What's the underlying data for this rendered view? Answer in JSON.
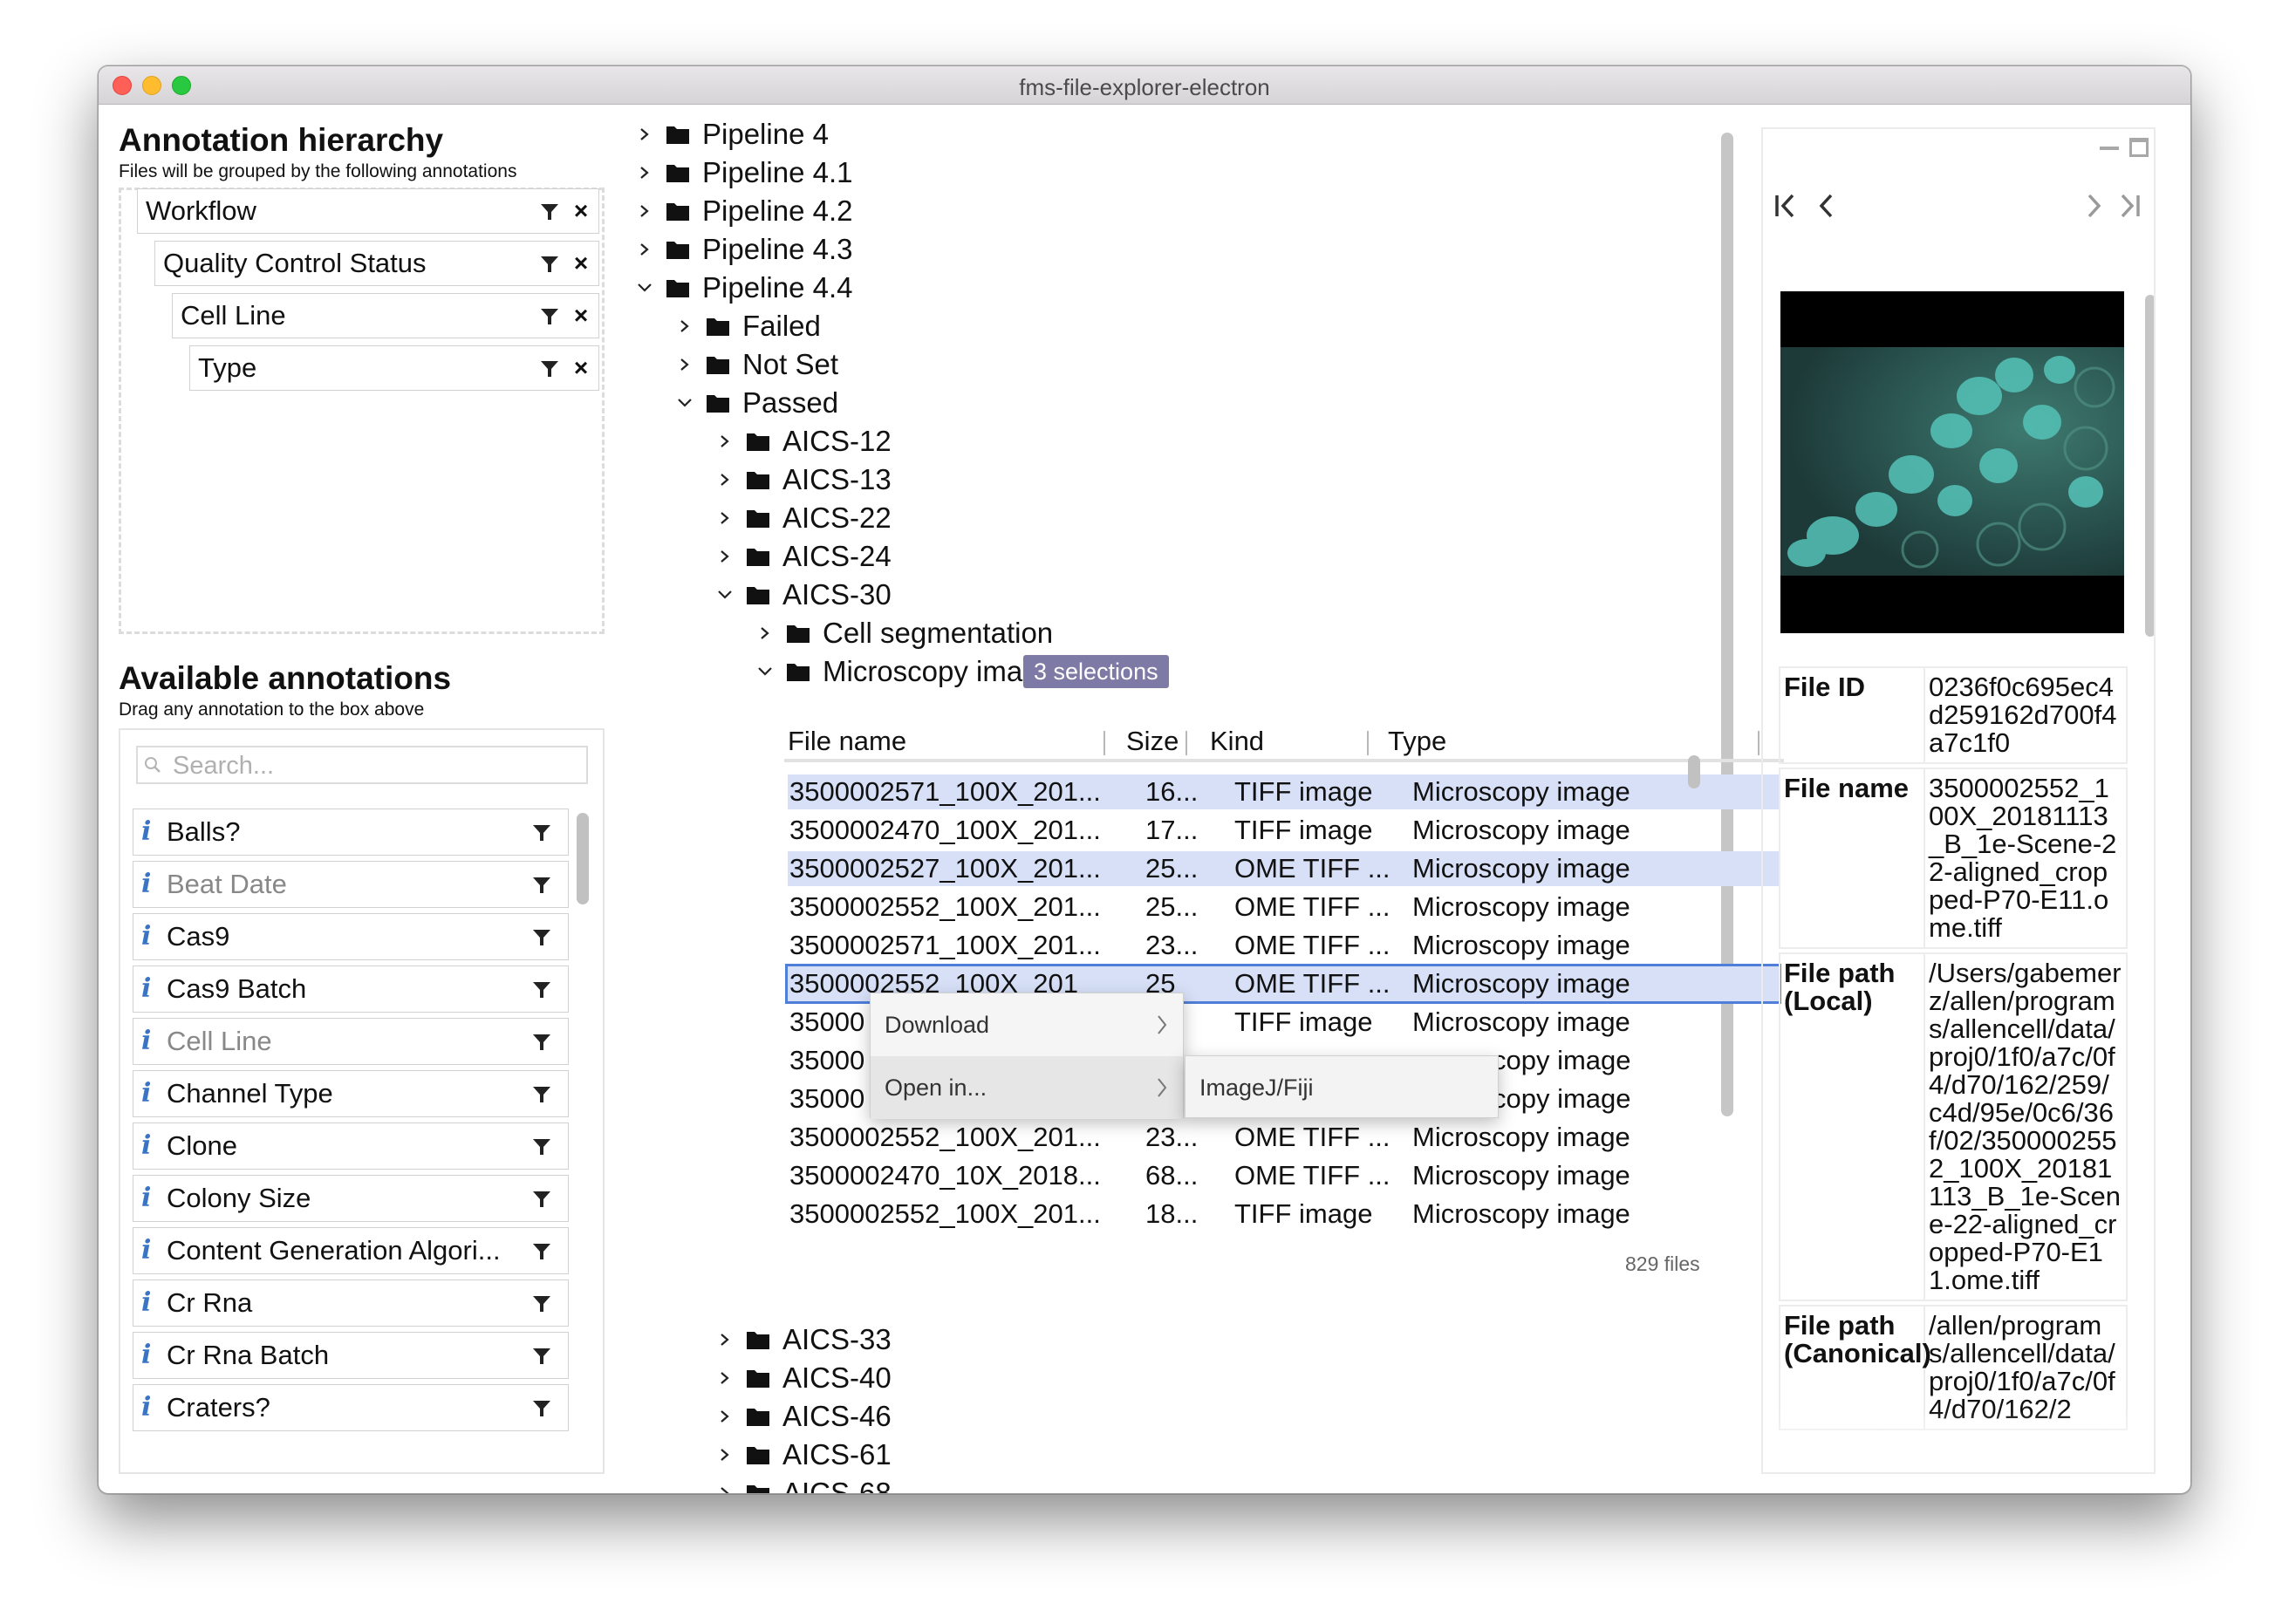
{
  "window": {
    "title": "fms-file-explorer-electron"
  },
  "hierarchy": {
    "title": "Annotation hierarchy",
    "subtitle": "Files will be grouped by the following annotations",
    "items": [
      {
        "label": "Workflow"
      },
      {
        "label": "Quality Control Status"
      },
      {
        "label": "Cell Line"
      },
      {
        "label": "Type"
      }
    ]
  },
  "available": {
    "title": "Available annotations",
    "subtitle": "Drag any annotation to the box above",
    "search_placeholder": "Search...",
    "items": [
      {
        "label": "Balls?"
      },
      {
        "label": "Beat Date"
      },
      {
        "label": "Cas9"
      },
      {
        "label": "Cas9 Batch"
      },
      {
        "label": "Cell Line"
      },
      {
        "label": "Channel Type"
      },
      {
        "label": "Clone"
      },
      {
        "label": "Colony Size"
      },
      {
        "label": "Content Generation Algori..."
      },
      {
        "label": "Cr Rna"
      },
      {
        "label": "Cr Rna Batch"
      },
      {
        "label": "Craters?"
      }
    ]
  },
  "tree": {
    "pipelines": [
      "Pipeline 4",
      "Pipeline 4.1",
      "Pipeline 4.2",
      "Pipeline 4.3",
      "Pipeline 4.4"
    ],
    "qc": [
      "Failed",
      "Not Set",
      "Passed"
    ],
    "cell_lines_top": [
      "AICS-12",
      "AICS-13",
      "AICS-22",
      "AICS-24",
      "AICS-30"
    ],
    "types": [
      "Cell segmentation",
      "Microscopy image"
    ],
    "selection_badge": "3 selections",
    "cell_lines_bottom": [
      "AICS-33",
      "AICS-40",
      "AICS-46",
      "AICS-61",
      "AICS-68"
    ]
  },
  "table": {
    "columns": [
      "File name",
      "Size",
      "Kind",
      "Type"
    ],
    "rows": [
      {
        "name": "3500002571_100X_201...",
        "size": "16...",
        "kind": "TIFF image",
        "type": "Microscopy image"
      },
      {
        "name": "3500002470_100X_201...",
        "size": "17...",
        "kind": "TIFF image",
        "type": "Microscopy image"
      },
      {
        "name": "3500002527_100X_201...",
        "size": "25...",
        "kind": "OME TIFF ...",
        "type": "Microscopy image"
      },
      {
        "name": "3500002552_100X_201...",
        "size": "25...",
        "kind": "OME TIFF ...",
        "type": "Microscopy image"
      },
      {
        "name": "3500002571_100X_201...",
        "size": "23...",
        "kind": "OME TIFF ...",
        "type": "Microscopy image"
      },
      {
        "name": "3500002552_100X_201",
        "size": "25",
        "kind": "OME TIFF ...",
        "type": "Microscopy image"
      },
      {
        "name": "35000",
        "size": "",
        "kind": "TIFF image",
        "type": "Microscopy image"
      },
      {
        "name": "35000",
        "size": "",
        "kind": "",
        "type": "copy image"
      },
      {
        "name": "35000",
        "size": "",
        "kind": "",
        "type": "copy image"
      },
      {
        "name": "3500002552_100X_201...",
        "size": "23...",
        "kind": "OME TIFF ...",
        "type": "Microscopy image"
      },
      {
        "name": "3500002470_10X_2018...",
        "size": "68....",
        "kind": "OME TIFF ...",
        "type": "Microscopy image"
      },
      {
        "name": "3500002552_100X_201...",
        "size": "18...",
        "kind": "TIFF image",
        "type": "Microscopy image"
      }
    ],
    "file_count": "829 files"
  },
  "context_menu": {
    "download": "Download",
    "open_in": "Open in...",
    "submenu_item": "ImageJ/Fiji"
  },
  "details": {
    "rows": [
      {
        "key": "File ID",
        "value": "0236f0c695ec4d259162d700f4a7c1f0"
      },
      {
        "key": "File name",
        "value": "3500002552_100X_20181113_B_1e-Scene-22-aligned_cropped-P70-E11.ome.tiff"
      },
      {
        "key": "File path (Local)",
        "value": "/Users/gabemerz/allen/programs/allencell/data/proj0/1f0/a7c/0f4/d70/162/259/c4d/95e/0c6/36f/02/3500002552_100X_20181113_B_1e-Scene-22-aligned_cropped-P70-E11.ome.tiff"
      },
      {
        "key": "File path (Canonical)",
        "value": "/allen/programs/allencell/data/proj0/1f0/a7c/0f4/d70/162/2"
      }
    ]
  },
  "colors": {
    "badge": "#7d7ba6",
    "selected_row": "#d7e0f7",
    "focus_outline": "#4f7fd8",
    "info_icon": "#3a74c4"
  }
}
